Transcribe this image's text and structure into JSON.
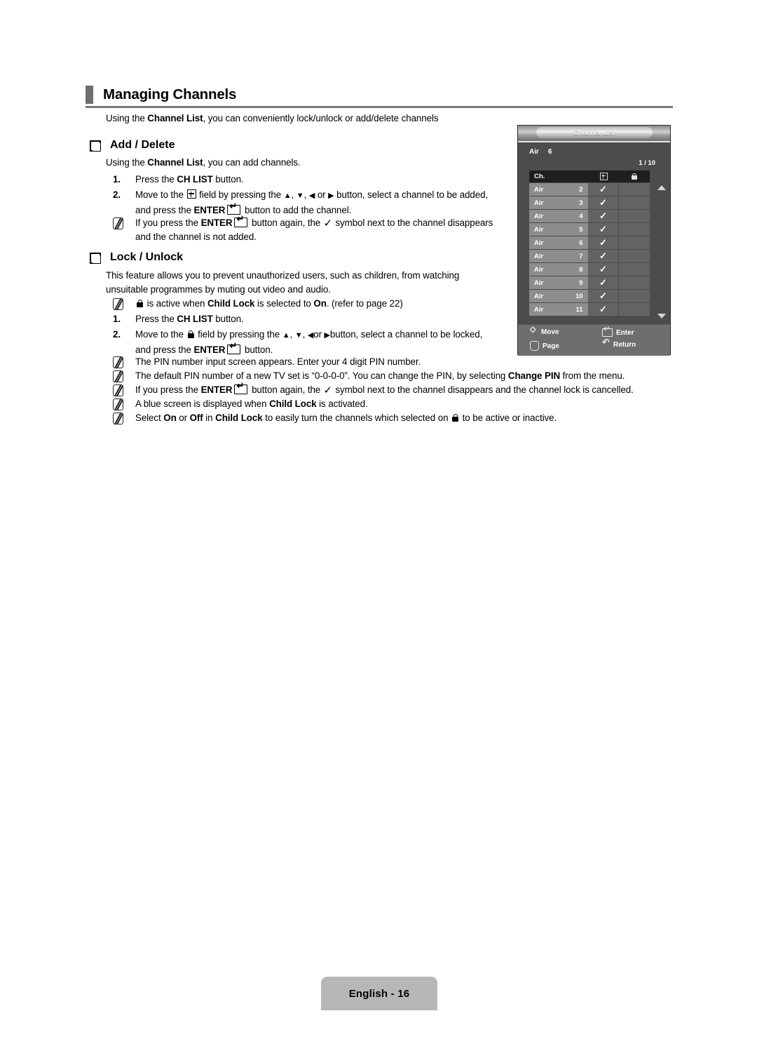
{
  "page": {
    "title": "Managing Channels",
    "intro_prefix": "Using the ",
    "intro_bold": "Channel List",
    "intro_suffix": ", you can conveniently lock/unlock or add/delete channels",
    "footer_label": "English - 16"
  },
  "add_delete": {
    "heading": "Add / Delete",
    "intro_prefix": "Using the ",
    "intro_bold": "Channel List",
    "intro_suffix": ", you can add channels.",
    "step1_num": "1.",
    "step1_a": "Press the ",
    "step1_bold": "CH LIST",
    "step1_b": " button.",
    "step2_num": "2.",
    "step2_a": "Move to the ",
    "step2_b": " field by pressing the ",
    "step2_arrows_1": "▲",
    "step2_arrows_2": "▼",
    "step2_arrows_3": "◀",
    "step2_or": " or ",
    "step2_arrows_4": "▶",
    "step2_c": " button, select a channel to be added,",
    "step2_d": "and press the ",
    "step2_bold": "ENTER",
    "step2_e": " button to add the channel.",
    "note1_a": "If you press the ",
    "note1_bold": "ENTER",
    "note1_b": " button again, the ",
    "note1_check": "✓",
    "note1_c": " symbol next to the channel disappears",
    "note1_d": "and the channel is not added."
  },
  "lock_unlock": {
    "heading": "Lock / Unlock",
    "intro_l1": "This feature allows you to prevent unauthorized users, such as children, from watching",
    "intro_l2": "unsuitable programmes by muting out video and audio.",
    "note_lock_a": " is active when ",
    "note_lock_bold1": "Child Lock",
    "note_lock_b": " is selected to ",
    "note_lock_bold2": "On",
    "note_lock_c": ". (refer to page 22)",
    "step1_num": "1.",
    "step1_a": "Press the ",
    "step1_bold": "CH LIST",
    "step1_b": " button.",
    "step2_num": "2.",
    "step2_a": "Move to the ",
    "step2_b": " field by pressing the ",
    "step2_arrows_1": "▲",
    "step2_arrows_2": "▼",
    "step2_arrows_3": "◀",
    "step2_or": "or ",
    "step2_arrows_4": "▶",
    "step2_c": "button, select a channel to be locked,",
    "step2_d": "and press the ",
    "step2_bold": "ENTER",
    "step2_e": " button.",
    "notes": {
      "n1": "The PIN number input screen appears. Enter your 4 digit PIN number.",
      "n2_a": "The default PIN number of a new TV set is “0-0-0-0”. You can change the PIN, by selecting ",
      "n2_bold": "Change PIN",
      "n2_b": " from the menu.",
      "n3_a": "If you press the ",
      "n3_bold": "ENTER",
      "n3_b": " button again, the ",
      "n3_check": "✓",
      "n3_c": " symbol next to the channel disappears and the channel lock is cancelled.",
      "n4_a": "A blue screen is displayed when ",
      "n4_bold": "Child Lock",
      "n4_b": " is activated.",
      "n5_a": "Select ",
      "n5_bold1": "On",
      "n5_b": " or ",
      "n5_bold2": "Off",
      "n5_c": " in ",
      "n5_bold3": "Child Lock",
      "n5_d": " to easily turn the channels which selected on ",
      "n5_e": " to be active or inactive."
    }
  },
  "osd": {
    "title": "Channel List",
    "current_source": "Air",
    "current_channel": "6",
    "page_indicator": "1 / 10",
    "columns": {
      "ch": "Ch.",
      "add_icon": "plus-icon",
      "lock_icon": "lock-icon"
    },
    "rows": [
      {
        "source": "Air",
        "number": "2",
        "added": "✓",
        "locked": ""
      },
      {
        "source": "Air",
        "number": "3",
        "added": "✓",
        "locked": ""
      },
      {
        "source": "Air",
        "number": "4",
        "added": "✓",
        "locked": ""
      },
      {
        "source": "Air",
        "number": "5",
        "added": "✓",
        "locked": ""
      },
      {
        "source": "Air",
        "number": "6",
        "added": "✓",
        "locked": ""
      },
      {
        "source": "Air",
        "number": "7",
        "added": "✓",
        "locked": ""
      },
      {
        "source": "Air",
        "number": "8",
        "added": "✓",
        "locked": ""
      },
      {
        "source": "Air",
        "number": "9",
        "added": "✓",
        "locked": ""
      },
      {
        "source": "Air",
        "number": "10",
        "added": "✓",
        "locked": ""
      },
      {
        "source": "Air",
        "number": "11",
        "added": "✓",
        "locked": ""
      }
    ],
    "actions": {
      "add": "Add",
      "lock": "Lock"
    },
    "help": {
      "move": "Move",
      "page": "Page",
      "enter": "Enter",
      "return": "Return"
    }
  },
  "colors": {
    "osd_background": "#4c4c4c",
    "osd_row_label": "#8d8d8d",
    "osd_row_cell": "#636363",
    "osd_header": "#1f1f1f",
    "osd_help_bar": "#6e6e6e",
    "title_bullet": "#6e6e6e",
    "footer_tab": "#b7b7b7"
  }
}
